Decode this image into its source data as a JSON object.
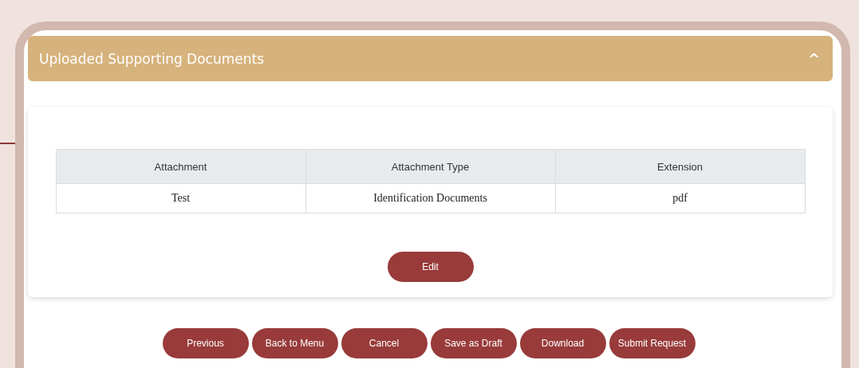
{
  "section": {
    "title": "Uploaded Supporting Documents",
    "toggle": "^"
  },
  "table": {
    "columns": [
      "Attachment",
      "Attachment Type",
      "Extension"
    ],
    "rows": [
      [
        "Test",
        "Identification Documents",
        "pdf"
      ]
    ]
  },
  "edit_button": "Edit",
  "buttons": [
    "Previous",
    "Back to Menu",
    "Cancel",
    "Save as Draft",
    "Download",
    "Submit Request"
  ]
}
